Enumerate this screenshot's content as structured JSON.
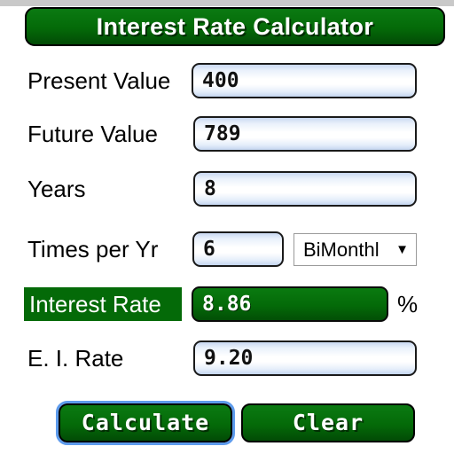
{
  "app": {
    "title": "Interest Rate Calculator"
  },
  "rows": [
    {
      "label": "Present Value",
      "value": "400",
      "field": "present-value"
    },
    {
      "label": "Future Value",
      "value": "789",
      "field": "future-value"
    },
    {
      "label": "Years",
      "value": "8",
      "field": "years"
    },
    {
      "label": "Times per Yr",
      "value": "6",
      "field": "times-per-year"
    },
    {
      "label": "Interest Rate",
      "value": "8.86",
      "field": "interest-rate"
    },
    {
      "label": "E. I. Rate",
      "value": "9.20",
      "field": "effective-interest-rate"
    }
  ],
  "compounding": {
    "selected": "BiMonthl",
    "caret": "▼"
  },
  "units": {
    "percent": "%"
  },
  "buttons": {
    "calculate": "Calculate",
    "clear": "Clear"
  },
  "colors": {
    "brand_green": "#046a08",
    "focus_blue": "#5d9bec",
    "topbar_gray": "#c9c9c9"
  }
}
